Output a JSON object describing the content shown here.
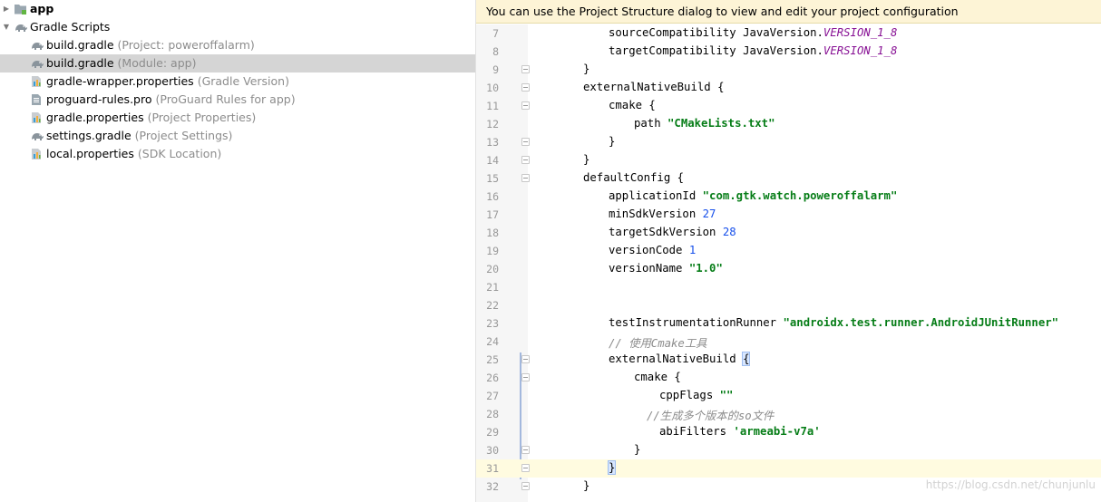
{
  "tree": {
    "items": [
      {
        "name": "app",
        "desc": "",
        "icon": "module-folder-icon",
        "bold": true
      },
      {
        "name": "Gradle Scripts",
        "desc": "",
        "icon": "gradle-elephant-icon",
        "bold": false
      },
      {
        "name": "build.gradle",
        "desc": "(Project: poweroffalarm)",
        "icon": "gradle-elephant-icon",
        "bold": false
      },
      {
        "name": "build.gradle",
        "desc": "(Module: app)",
        "icon": "gradle-elephant-icon",
        "bold": false,
        "selected": true
      },
      {
        "name": "gradle-wrapper.properties",
        "desc": "(Gradle Version)",
        "icon": "properties-file-icon",
        "bold": false
      },
      {
        "name": "proguard-rules.pro",
        "desc": "(ProGuard Rules for app)",
        "icon": "text-file-icon",
        "bold": false
      },
      {
        "name": "gradle.properties",
        "desc": "(Project Properties)",
        "icon": "properties-file-icon",
        "bold": false
      },
      {
        "name": "settings.gradle",
        "desc": "(Project Settings)",
        "icon": "gradle-elephant-icon",
        "bold": false
      },
      {
        "name": "local.properties",
        "desc": "(SDK Location)",
        "icon": "properties-file-icon",
        "bold": false
      }
    ]
  },
  "editor": {
    "banner": "You can use the Project Structure dialog to view and edit your project configuration",
    "lines": [
      {
        "n": "7",
        "indent": 2,
        "tokens": [
          [
            "sourceCompatibility JavaVersion.",
            ""
          ],
          [
            "VERSION_1_8",
            "const"
          ]
        ]
      },
      {
        "n": "8",
        "indent": 2,
        "tokens": [
          [
            "targetCompatibility JavaVersion.",
            ""
          ],
          [
            "VERSION_1_8",
            "const"
          ]
        ]
      },
      {
        "n": "9",
        "indent": 1,
        "fold": true,
        "tokens": [
          [
            "}",
            ""
          ]
        ]
      },
      {
        "n": "10",
        "indent": 1,
        "fold": true,
        "tokens": [
          [
            "externalNativeBuild {",
            ""
          ]
        ]
      },
      {
        "n": "11",
        "indent": 2,
        "fold": true,
        "tokens": [
          [
            "cmake {",
            ""
          ]
        ]
      },
      {
        "n": "12",
        "indent": 3,
        "tokens": [
          [
            "path ",
            ""
          ],
          [
            "\"CMakeLists.txt\"",
            "str"
          ]
        ]
      },
      {
        "n": "13",
        "indent": 2,
        "fold": true,
        "tokens": [
          [
            "}",
            ""
          ]
        ]
      },
      {
        "n": "14",
        "indent": 1,
        "fold": true,
        "tokens": [
          [
            "}",
            ""
          ]
        ]
      },
      {
        "n": "15",
        "indent": 1,
        "fold": true,
        "tokens": [
          [
            "defaultConfig {",
            ""
          ]
        ]
      },
      {
        "n": "16",
        "indent": 2,
        "tokens": [
          [
            "applicationId ",
            ""
          ],
          [
            "\"com.gtk.watch.poweroffalarm\"",
            "str"
          ]
        ]
      },
      {
        "n": "17",
        "indent": 2,
        "tokens": [
          [
            "minSdkVersion ",
            ""
          ],
          [
            "27",
            "num"
          ]
        ]
      },
      {
        "n": "18",
        "indent": 2,
        "tokens": [
          [
            "targetSdkVersion ",
            ""
          ],
          [
            "28",
            "num"
          ]
        ]
      },
      {
        "n": "19",
        "indent": 2,
        "tokens": [
          [
            "versionCode ",
            ""
          ],
          [
            "1",
            "num"
          ]
        ]
      },
      {
        "n": "20",
        "indent": 2,
        "tokens": [
          [
            "versionName ",
            ""
          ],
          [
            "\"1.0\"",
            "str"
          ]
        ]
      },
      {
        "n": "21",
        "indent": 0,
        "tokens": []
      },
      {
        "n": "22",
        "indent": 0,
        "tokens": []
      },
      {
        "n": "23",
        "indent": 2,
        "tokens": [
          [
            "testInstrumentationRunner ",
            ""
          ],
          [
            "\"androidx.test.runner.AndroidJUnitRunner\"",
            "str"
          ]
        ]
      },
      {
        "n": "24",
        "indent": 2,
        "tokens": [
          [
            "// 使用Cmake工具",
            "com"
          ]
        ]
      },
      {
        "n": "25",
        "indent": 2,
        "fold": true,
        "tokens": [
          [
            "externalNativeBuild ",
            ""
          ],
          [
            "{",
            "brace"
          ]
        ]
      },
      {
        "n": "26",
        "indent": 3,
        "fold": true,
        "tokens": [
          [
            "cmake {",
            ""
          ]
        ]
      },
      {
        "n": "27",
        "indent": 4,
        "tokens": [
          [
            "cppFlags ",
            ""
          ],
          [
            "\"\"",
            "str"
          ]
        ]
      },
      {
        "n": "28",
        "indent": 3.5,
        "tokens": [
          [
            "//生成多个版本的so文件",
            "com"
          ]
        ]
      },
      {
        "n": "29",
        "indent": 4,
        "tokens": [
          [
            "abiFilters ",
            ""
          ],
          [
            "'armeabi-v7a'",
            "str"
          ]
        ]
      },
      {
        "n": "30",
        "indent": 3,
        "fold": true,
        "tokens": [
          [
            "}",
            ""
          ]
        ]
      },
      {
        "n": "31",
        "indent": 2,
        "fold": true,
        "current": true,
        "tokens": [
          [
            "}",
            "brace"
          ]
        ]
      },
      {
        "n": "32",
        "indent": 1,
        "fold": true,
        "tokens": [
          [
            "}",
            ""
          ]
        ]
      }
    ]
  },
  "watermark": "https://blog.csdn.net/chunjunlu"
}
